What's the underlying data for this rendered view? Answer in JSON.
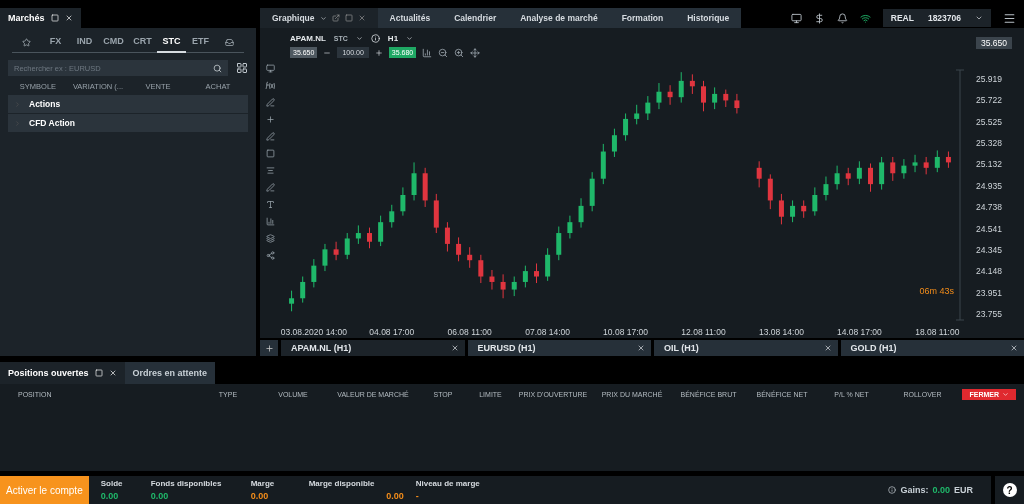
{
  "markets_panel": {
    "title": "Marchés",
    "tabs": [
      {
        "label": "FX",
        "selected": false
      },
      {
        "label": "IND",
        "selected": false
      },
      {
        "label": "CMD",
        "selected": false
      },
      {
        "label": "CRT",
        "selected": false
      },
      {
        "label": "STC",
        "selected": true
      },
      {
        "label": "ETF",
        "selected": false
      }
    ],
    "search": {
      "placeholder": "Rechercher ex : EURUSD"
    },
    "columns": [
      "SYMBOLE",
      "VARIATION (...",
      "VENTE",
      "ACHAT"
    ],
    "groups": [
      {
        "label": "Actions",
        "expanded": false
      },
      {
        "label": "CFD Action",
        "expanded": false
      }
    ]
  },
  "top_tabs": [
    {
      "label": "Graphique",
      "selected": true
    },
    {
      "label": "Actualités",
      "selected": false
    },
    {
      "label": "Calendrier",
      "selected": false
    },
    {
      "label": "Analyse de marché",
      "selected": false
    },
    {
      "label": "Formation",
      "selected": false
    },
    {
      "label": "Historique",
      "selected": false
    }
  ],
  "account": {
    "type": "REAL",
    "number": "1823706"
  },
  "chart": {
    "symbol": "APAM.NL",
    "category": "STC",
    "timeframe": "H1",
    "sell": "35.650",
    "volume": "100.00",
    "buy": "35.680",
    "price_tag": "35.650",
    "countdown": "06m 43s",
    "x_labels": [
      "03.08.2020 14:00",
      "04.08 17:00",
      "06.08 11:00",
      "07.08 14:00",
      "10.08 17:00",
      "12.08 11:00",
      "13.08 14:00",
      "14.08 17:00",
      "18.08 11:00"
    ],
    "chart_data": {
      "type": "candlestick",
      "ylim": [
        23.7,
        26.0
      ],
      "yticks": [
        {
          "value": 25.919,
          "label": "25.919"
        },
        {
          "value": 25.722,
          "label": "25.722"
        },
        {
          "value": 25.525,
          "label": "25.525"
        },
        {
          "value": 25.328,
          "label": "25.328"
        },
        {
          "value": 25.132,
          "label": "25.132"
        },
        {
          "value": 24.935,
          "label": "24.935"
        },
        {
          "value": 24.738,
          "label": "24.738"
        },
        {
          "value": 24.541,
          "label": "24.541"
        },
        {
          "value": 24.345,
          "label": "24.345"
        },
        {
          "value": 24.148,
          "label": "24.148"
        },
        {
          "value": 23.951,
          "label": "23.951"
        },
        {
          "value": 23.755,
          "label": "23.755"
        }
      ],
      "ohlc": [
        [
          23.85,
          23.97,
          23.78,
          23.9
        ],
        [
          23.9,
          24.1,
          23.86,
          24.05
        ],
        [
          24.05,
          24.26,
          24.0,
          24.2
        ],
        [
          24.2,
          24.4,
          24.15,
          24.35
        ],
        [
          24.35,
          24.42,
          24.25,
          24.3
        ],
        [
          24.3,
          24.5,
          24.26,
          24.45
        ],
        [
          24.45,
          24.57,
          24.4,
          24.5
        ],
        [
          24.5,
          24.55,
          24.36,
          24.42
        ],
        [
          24.42,
          24.66,
          24.38,
          24.6
        ],
        [
          24.6,
          24.76,
          24.55,
          24.7
        ],
        [
          24.7,
          24.92,
          24.66,
          24.85
        ],
        [
          24.85,
          25.15,
          24.8,
          25.05
        ],
        [
          25.05,
          25.1,
          24.74,
          24.8
        ],
        [
          24.8,
          24.86,
          24.5,
          24.55
        ],
        [
          24.55,
          24.6,
          24.33,
          24.4
        ],
        [
          24.4,
          24.46,
          24.24,
          24.3
        ],
        [
          24.3,
          24.37,
          24.18,
          24.25
        ],
        [
          24.25,
          24.3,
          24.04,
          24.1
        ],
        [
          24.1,
          24.16,
          23.98,
          24.05
        ],
        [
          24.05,
          24.12,
          23.9,
          23.98
        ],
        [
          23.98,
          24.1,
          23.92,
          24.05
        ],
        [
          24.05,
          24.2,
          24.0,
          24.15
        ],
        [
          24.15,
          24.22,
          24.04,
          24.1
        ],
        [
          24.1,
          24.36,
          24.06,
          24.3
        ],
        [
          24.3,
          24.56,
          24.25,
          24.5
        ],
        [
          24.5,
          24.66,
          24.45,
          24.6
        ],
        [
          24.6,
          24.82,
          24.55,
          24.75
        ],
        [
          24.75,
          25.06,
          24.7,
          25.0
        ],
        [
          25.0,
          25.32,
          24.95,
          25.25
        ],
        [
          25.25,
          25.46,
          25.2,
          25.4
        ],
        [
          25.4,
          25.6,
          25.35,
          25.55
        ],
        [
          25.55,
          25.68,
          25.5,
          25.6
        ],
        [
          25.6,
          25.76,
          25.54,
          25.7
        ],
        [
          25.7,
          25.88,
          25.64,
          25.8
        ],
        [
          25.8,
          25.86,
          25.68,
          25.75
        ],
        [
          25.75,
          25.98,
          25.7,
          25.9
        ],
        [
          25.9,
          25.96,
          25.78,
          25.85
        ],
        [
          25.85,
          25.9,
          25.62,
          25.7
        ],
        [
          25.7,
          25.84,
          25.64,
          25.78
        ],
        [
          25.78,
          25.82,
          25.66,
          25.72
        ],
        [
          25.72,
          25.78,
          25.6,
          25.65
        ],
        null,
        [
          25.1,
          25.16,
          24.92,
          25.0
        ],
        [
          25.0,
          25.04,
          24.72,
          24.8
        ],
        [
          24.8,
          24.86,
          24.58,
          24.65
        ],
        [
          24.65,
          24.8,
          24.6,
          24.75
        ],
        [
          24.75,
          24.8,
          24.64,
          24.7
        ],
        [
          24.7,
          24.92,
          24.66,
          24.85
        ],
        [
          24.85,
          25.02,
          24.8,
          24.95
        ],
        [
          24.95,
          25.12,
          24.9,
          25.05
        ],
        [
          25.05,
          25.1,
          24.94,
          25.0
        ],
        [
          25.0,
          25.16,
          24.95,
          25.1
        ],
        [
          25.1,
          25.14,
          24.88,
          24.95
        ],
        [
          24.95,
          25.2,
          24.9,
          25.15
        ],
        [
          25.15,
          25.2,
          24.98,
          25.05
        ],
        [
          25.05,
          25.18,
          25.0,
          25.12
        ],
        [
          25.12,
          25.22,
          25.06,
          25.15
        ],
        [
          25.15,
          25.2,
          25.04,
          25.1
        ],
        [
          25.1,
          25.26,
          25.06,
          25.2
        ],
        [
          25.2,
          25.25,
          25.1,
          25.15
        ]
      ]
    }
  },
  "chart_tabs": [
    {
      "label": "APAM.NL (H1)",
      "selected": true
    },
    {
      "label": "EURUSD (H1)",
      "selected": false
    },
    {
      "label": "OIL (H1)",
      "selected": false
    },
    {
      "label": "GOLD (H1)",
      "selected": false
    }
  ],
  "positions_panel": {
    "tabs": [
      {
        "label": "Positions ouvertes",
        "selected": true
      },
      {
        "label": "Ordres en attente",
        "selected": false
      }
    ],
    "columns": [
      "POSITION",
      "TYPE",
      "VOLUME",
      "VALEUR DE MARCHÉ",
      "STOP",
      "LIMITE",
      "PRIX D'OUVERTURE",
      "PRIX DU MARCHÉ",
      "BÉNÉFICE BRUT",
      "BÉNÉFICE NET",
      "P/L % NET",
      "ROLLOVER"
    ],
    "close_button": "FERMER"
  },
  "footer": {
    "activate_button": "Activer le compte",
    "stats": [
      {
        "label": "Solde",
        "value": "0.00",
        "kind": "funds"
      },
      {
        "label": "Fonds disponibles",
        "value": "0.00",
        "kind": "funds"
      },
      {
        "label": "Marge",
        "value": "0.00",
        "kind": "margin"
      },
      {
        "label": "Marge disponible",
        "value": "0.00",
        "kind": "margin"
      },
      {
        "label": "Niveau de marge",
        "value": "-",
        "kind": "margin"
      }
    ],
    "gains_label": "Gains:",
    "gains_value": "0.00",
    "currency": "EUR",
    "help": "?"
  }
}
